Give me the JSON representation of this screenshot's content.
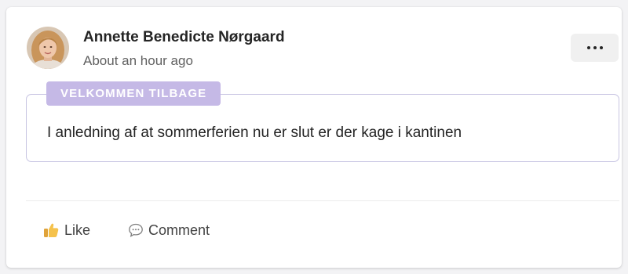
{
  "post": {
    "author_name": "Annette Benedicte Nørgaard",
    "timestamp": "About an hour ago",
    "more_icon": "ellipsis-icon",
    "tag": "VELKOMMEN TILBAGE",
    "message": "I anledning af at sommerferien nu er slut er der kage i kantinen"
  },
  "actions": {
    "like_label": "Like",
    "like_icon": "thumbs-up-icon",
    "comment_label": "Comment",
    "comment_icon": "speech-bubble-icon"
  },
  "colors": {
    "tag_background": "#c5b9e6",
    "message_border": "#c7c4e2",
    "like_icon": "#f2b83c",
    "text_primary": "#242424",
    "text_secondary": "#616161"
  }
}
